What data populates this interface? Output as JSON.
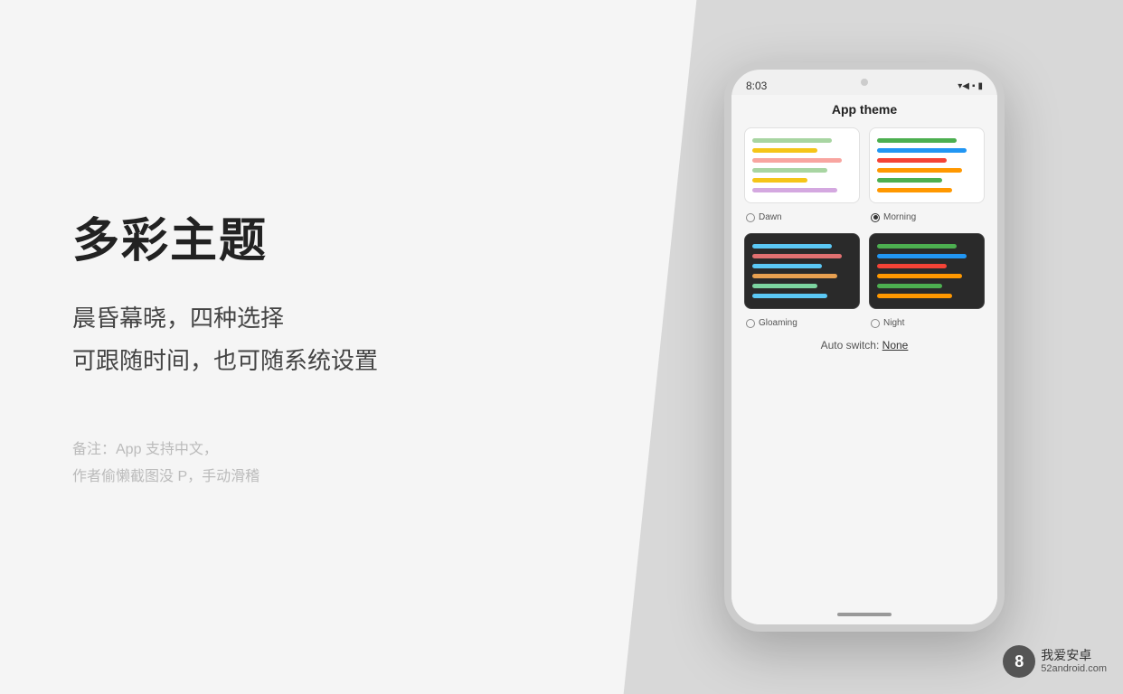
{
  "left": {
    "main_title": "多彩主题",
    "subtitle_line1": "晨昏幕晓，四种选择",
    "subtitle_line2": "可跟随时间，也可随系统设置",
    "note_line1": "备注：App 支持中文，",
    "note_line2": "作者偷懒截图没 P，手动滑稽"
  },
  "phone": {
    "time": "8:03",
    "app_theme_title": "App theme",
    "themes": [
      {
        "id": "dawn",
        "label": "Dawn",
        "selected": false,
        "dark": false
      },
      {
        "id": "morning",
        "label": "Morning",
        "selected": true,
        "dark": false
      },
      {
        "id": "gloaming",
        "label": "Gloaming",
        "selected": false,
        "dark": true
      },
      {
        "id": "night",
        "label": "Night",
        "selected": false,
        "dark": true
      }
    ],
    "auto_switch_label": "Auto switch:",
    "auto_switch_value": "None"
  },
  "watermark": {
    "icon": "8",
    "line1": "我爱安卓",
    "line2": "52android.com"
  }
}
